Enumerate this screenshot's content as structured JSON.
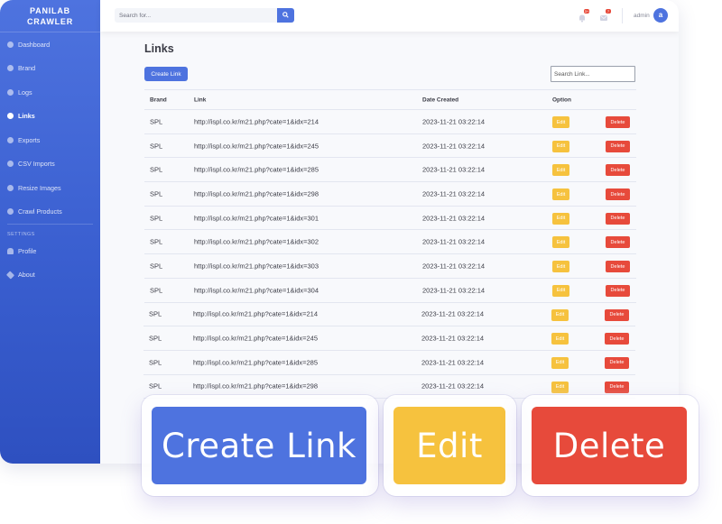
{
  "app": {
    "brand_line1": "PANILAB",
    "brand_line2": "CRAWLER"
  },
  "sidebar": {
    "items": [
      {
        "label": "Dashboard",
        "icon": "dashboard-icon",
        "active": false
      },
      {
        "label": "Brand",
        "icon": "brand-icon",
        "active": false
      },
      {
        "label": "Logs",
        "icon": "logs-icon",
        "active": false
      },
      {
        "label": "Links",
        "icon": "links-icon",
        "active": true
      },
      {
        "label": "Exports",
        "icon": "exports-icon",
        "active": false
      },
      {
        "label": "CSV Imports",
        "icon": "csv-import-icon",
        "active": false
      },
      {
        "label": "Resize Images",
        "icon": "resize-images-icon",
        "active": false
      },
      {
        "label": "Crawl Products",
        "icon": "crawl-icon",
        "active": false
      }
    ],
    "settings_heading": "SETTINGS",
    "settings_items": [
      {
        "label": "Profile",
        "icon": "user-icon"
      },
      {
        "label": "About",
        "icon": "about-icon"
      }
    ]
  },
  "topbar": {
    "search_placeholder": "Search for...",
    "alerts_badge": "3+",
    "messages_badge": "7",
    "user_name": "admin",
    "avatar_letter": "a"
  },
  "main": {
    "title": "Links",
    "create_label": "Create Link",
    "search_placeholder": "Search Link...",
    "columns": [
      "Brand",
      "Link",
      "Date Created",
      "Option"
    ],
    "edit_label": "Edit",
    "delete_label": "Delete",
    "rows": [
      {
        "brand": "SPL",
        "link": "http://ispl.co.kr/m21.php?cate=1&idx=214",
        "date": "2023-11-21 03:22:14"
      },
      {
        "brand": "SPL",
        "link": "http://ispl.co.kr/m21.php?cate=1&idx=245",
        "date": "2023-11-21 03:22:14"
      },
      {
        "brand": "SPL",
        "link": "http://ispl.co.kr/m21.php?cate=1&idx=285",
        "date": "2023-11-21 03:22:14"
      },
      {
        "brand": "SPL",
        "link": "http://ispl.co.kr/m21.php?cate=1&idx=298",
        "date": "2023-11-21 03:22:14"
      },
      {
        "brand": "SPL",
        "link": "http://ispl.co.kr/m21.php?cate=1&idx=301",
        "date": "2023-11-21 03:22:14"
      },
      {
        "brand": "SPL",
        "link": "http://ispl.co.kr/m21.php?cate=1&idx=302",
        "date": "2023-11-21 03:22:14"
      },
      {
        "brand": "SPL",
        "link": "http://ispl.co.kr/m21.php?cate=1&idx=303",
        "date": "2023-11-21 03:22:14"
      },
      {
        "brand": "SPL",
        "link": "http://ispl.co.kr/m21.php?cate=1&idx=304",
        "date": "2023-11-21 03:22:14"
      },
      {
        "brand": "SPL",
        "link": "http://ispl.co.kr/m21.php?cate=1&idx=214",
        "date": "2023-11-21 03:22:14"
      },
      {
        "brand": "SPL",
        "link": "http://ispl.co.kr/m21.php?cate=1&idx=245",
        "date": "2023-11-21 03:22:14"
      },
      {
        "brand": "SPL",
        "link": "http://ispl.co.kr/m21.php?cate=1&idx=285",
        "date": "2023-11-21 03:22:14"
      },
      {
        "brand": "SPL",
        "link": "http://ispl.co.kr/m21.php?cate=1&idx=298",
        "date": "2023-11-21 03:22:14"
      }
    ]
  },
  "callouts": {
    "create": "Create Link",
    "edit": "Edit",
    "delete": "Delete"
  },
  "colors": {
    "primary": "#4e73df",
    "warning": "#f6c23e",
    "danger": "#e74a3b",
    "text": "#3a3b45"
  }
}
